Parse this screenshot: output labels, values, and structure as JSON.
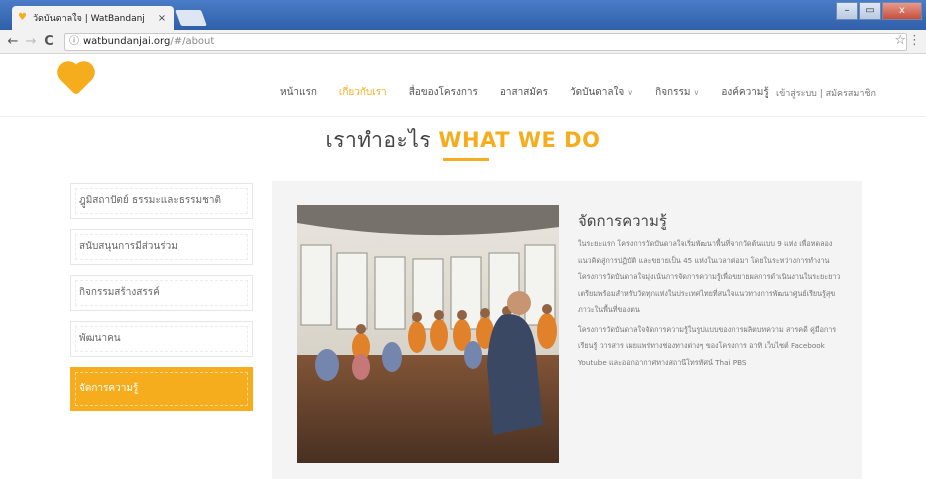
{
  "browser": {
    "tab_title": "วัดบันดาลใจ | WatBandanj",
    "tab_close": "×",
    "url_host": "watbundanjai.org",
    "url_path": "/#/about",
    "info_icon": "info-icon",
    "back": "←",
    "forward": "→",
    "reload": "C",
    "star": "☆",
    "menu": "⋮",
    "win_minimize": "–",
    "win_maximize": "▭",
    "win_close": "x"
  },
  "site": {
    "nav": [
      {
        "label": "หน้าแรก",
        "active": false,
        "caret": false
      },
      {
        "label": "เกี่ยวกับเรา",
        "active": true,
        "caret": false
      },
      {
        "label": "สื่อของโครงการ",
        "active": false,
        "caret": false
      },
      {
        "label": "อาสาสมัคร",
        "active": false,
        "caret": false
      },
      {
        "label": "วัดบันดาลใจ",
        "active": false,
        "caret": true
      },
      {
        "label": "กิจกรรม",
        "active": false,
        "caret": true
      },
      {
        "label": "องค์ความรู้",
        "active": false,
        "caret": false
      }
    ],
    "caret_glyph": "∨",
    "login": "เข้าสู่ระบบ | สมัครสมาชิก",
    "accent": "#f6ad1d"
  },
  "heading": {
    "thai": "เราทำอะไร ",
    "english": "WHAT WE DO"
  },
  "sidebar": {
    "items": [
      {
        "label": "ฎูมิสถาปัตย์ ธรรมะและธรรมชาติ",
        "active": false
      },
      {
        "label": "สนับสนุนการมีส่วนร่วม",
        "active": false
      },
      {
        "label": "กิจกรรมสร้างสรรค์",
        "active": false
      },
      {
        "label": "พัฒนาคน",
        "active": false
      },
      {
        "label": "จัดการความรู้",
        "active": true
      }
    ]
  },
  "content": {
    "title": "จัดการความรู้",
    "paragraph1": "ในระยะแรก โครงการวัดบันดาลใจเริ่มพัฒนาพื้นที่จากวัดต้นแบบ 9 แห่ง เพื่อทดลองแนวคิดสู่การปฏิบัติ และขยายเป็น 45 แห่งในเวลาต่อมา โดยในระหว่างการทำงาน โครงการวัดบันดาลใจมุ่งเน้นการจัดการความรู้เพื่อขยายผลการดำเนินงานในระยะยาว เตรียมพร้อมสำหรับวัดทุกแห่งในประเทศไทยที่สนใจแนวทางการพัฒนาศูนย์เรียนรู้สุขภาวะในพื้นที่ของตน",
    "paragraph2": "โครงการวัดบันดาลใจจัดการความรู้ในรูปแบบของการผลิตบทความ สารคดี คู่มือการเรียนรู้ วารสาร เผยแพร่ทางช่องทางต่างๆ ของโครงการ อาทิ เว็บไซต์ Facebook Youtube และออกอากาศทางสถานีโทรทัศน์ Thai PBS",
    "photo_icon": "classroom-photo"
  }
}
